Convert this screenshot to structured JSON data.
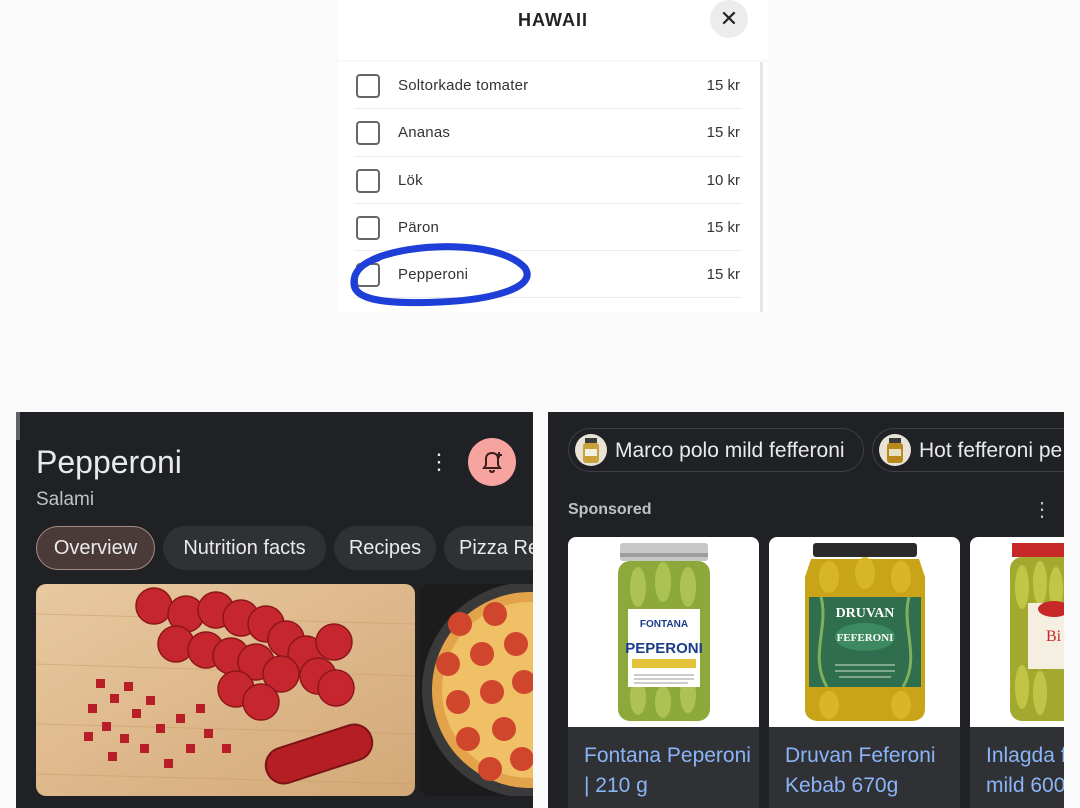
{
  "modal": {
    "title": "HAWAII",
    "close_icon": "close-icon",
    "options": [
      {
        "name": "Soltorkade tomater",
        "price": "15 kr"
      },
      {
        "name": "Ananas",
        "price": "15 kr"
      },
      {
        "name": "Lök",
        "price": "10 kr"
      },
      {
        "name": "Päron",
        "price": "15 kr"
      },
      {
        "name": "Pepperoni",
        "price": "15 kr"
      }
    ],
    "highlight_color": "#1d3fd8"
  },
  "knowledge_panel": {
    "title": "Pepperoni",
    "subtitle": "Salami",
    "more_icon": "more-vert-icon",
    "alert_icon": "bell-add-icon",
    "alert_color": "#f7a4a0",
    "chips": [
      {
        "label": "Overview"
      },
      {
        "label": "Nutrition facts"
      },
      {
        "label": "Recipes"
      },
      {
        "label": "Pizza Re"
      }
    ]
  },
  "shopping": {
    "suggestions": [
      {
        "label": "Marco polo mild fefferoni"
      },
      {
        "label": "Hot fefferoni pe"
      }
    ],
    "sponsored_label": "Sponsored",
    "more_icon": "more-vert-icon",
    "products": [
      {
        "name": "Fontana Peperoni | 210 g",
        "jar_label": [
          "FONTANA",
          "PEPERONI"
        ]
      },
      {
        "name": "Druvan Feferoni Kebab 670g",
        "jar_label": [
          "DRUVAN",
          "FEFERONI"
        ]
      },
      {
        "name": "Inlagda f mild 600",
        "jar_label": [
          "Bi"
        ]
      }
    ]
  }
}
